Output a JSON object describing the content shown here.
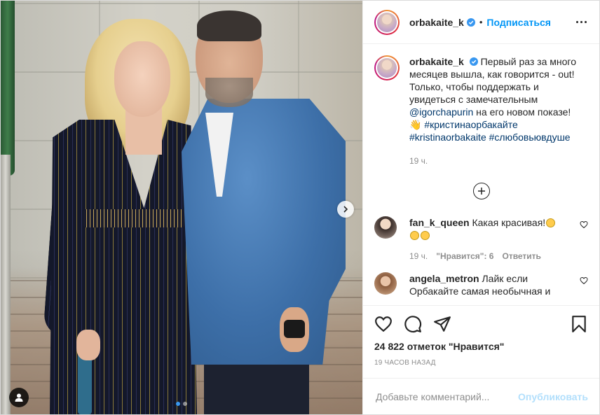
{
  "post": {
    "author": "orbakaite_k",
    "follow_label": "Подписаться",
    "separator": "•"
  },
  "caption": {
    "author": "orbakaite_k",
    "text_1": "Первый раз за много месяцев вышла, как говорится - out! Только, чтобы поддержать и увидеться с замечательным ",
    "mention": "@igorchapurin",
    "text_2": " на его новом показе!",
    "emoji": "👋",
    "hashtag_1": "#кристинаорбакайте",
    "hashtag_2": "#kristinaorbakaite",
    "hashtag_3": "#слюбовьювдуше",
    "time": "19 ч."
  },
  "comments": [
    {
      "author": "fan_k_queen",
      "text": "Какая красивая!",
      "time": "19 ч.",
      "likes": "\"Нравится\": 6",
      "reply": "Ответить"
    },
    {
      "author": "angela_metron",
      "text": "Лайк если Орбакайте самая необычная и"
    }
  ],
  "stats": {
    "likes": "24 822 отметок \"Нравится\"",
    "posted": "19 часов назад"
  },
  "comment_box": {
    "placeholder": "Добавьте комментарий...",
    "publish": "Опубликовать"
  },
  "carousel": {
    "current": 1,
    "total": 2
  },
  "colors": {
    "accent": "#0095f6",
    "link": "#00376b",
    "muted": "#8e8e8e"
  }
}
